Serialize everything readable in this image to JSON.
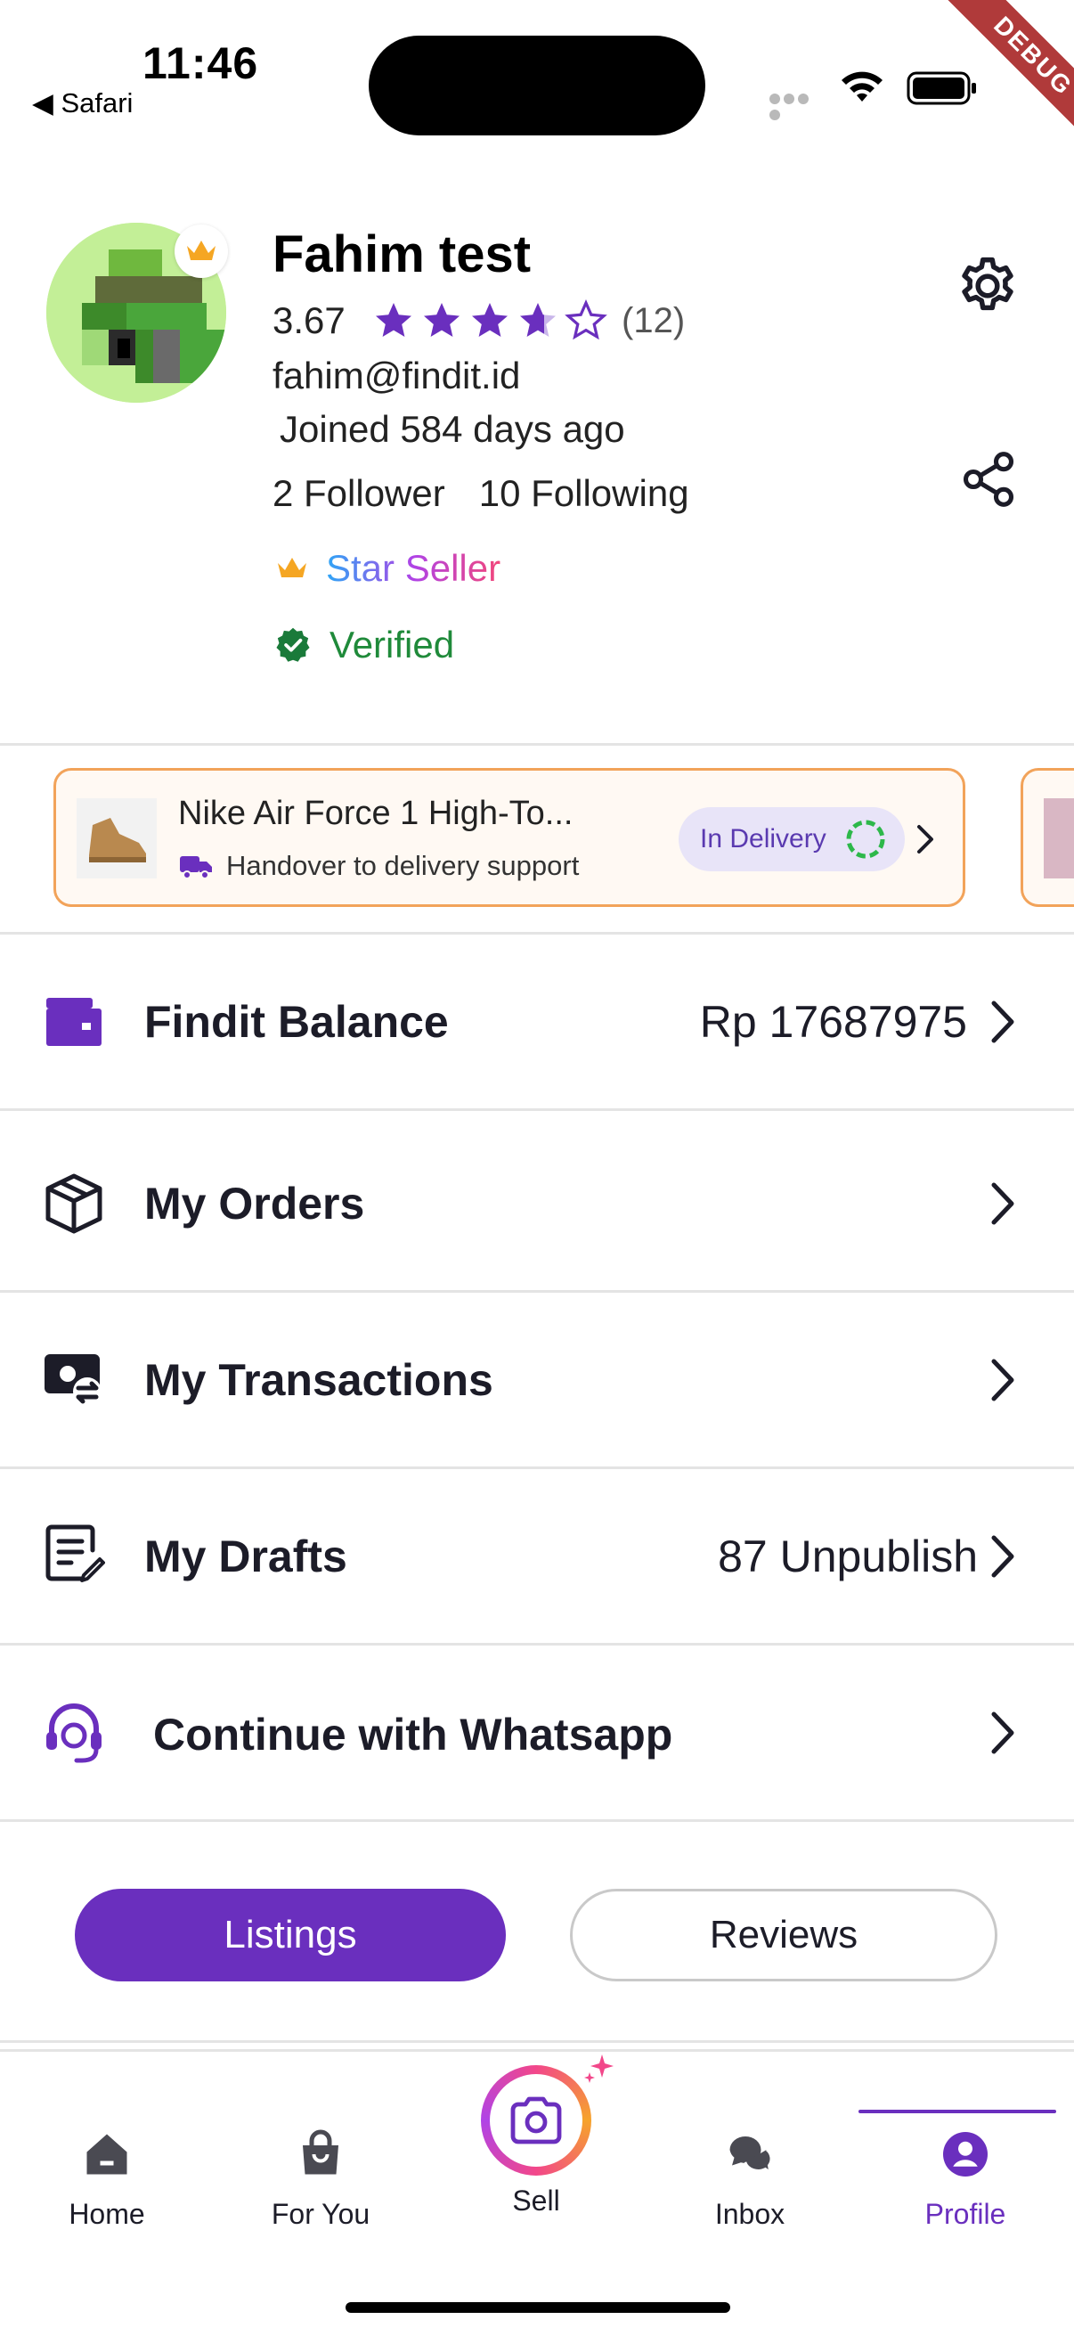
{
  "status_bar": {
    "time": "11:46",
    "back_app": "◀ Safari",
    "debug_label": "DEBUG"
  },
  "profile": {
    "name": "Fahim test",
    "rating": "3.67",
    "rating_stars": 3.67,
    "rating_count": "(12)",
    "email": "fahim@findit.id",
    "joined": "Joined 584 days ago",
    "followers": "2 Follower",
    "following": "10 Following",
    "star_seller_label": "Star Seller",
    "verified_label": "Verified"
  },
  "delivery_card": {
    "product_name": "Nike Air Force 1 High-To...",
    "subtitle": "Handover to delivery support",
    "status": "In Delivery"
  },
  "menu": {
    "balance_label": "Findit Balance",
    "balance_value": "Rp 17687975",
    "orders_label": "My Orders",
    "transactions_label": "My Transactions",
    "drafts_label": "My Drafts",
    "drafts_value": "87 Unpublish",
    "whatsapp_label": "Continue with Whatsapp"
  },
  "tabs": {
    "listings": "Listings",
    "reviews": "Reviews"
  },
  "bottom_nav": {
    "home": "Home",
    "for_you": "For You",
    "sell": "Sell",
    "inbox": "Inbox",
    "profile": "Profile"
  },
  "colors": {
    "accent": "#6a2fbe",
    "star": "#6a2fbe",
    "verified": "#1f8a3a",
    "card_border": "#f2a35a"
  }
}
